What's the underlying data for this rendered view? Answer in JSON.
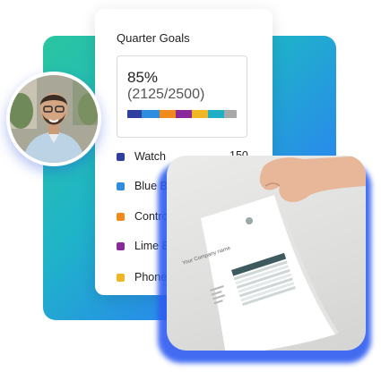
{
  "goals_card": {
    "title": "Quarter Goals",
    "percent": "85%",
    "ratio": "(2125/2500)",
    "progress_fraction": 0.85,
    "segments": [
      "#2f3fa0",
      "#2f8de0",
      "#f08a1c",
      "#8a2a9a",
      "#f1b624",
      "#1fb0c6",
      "#a8a8a8"
    ],
    "legend": [
      {
        "label": "Watch",
        "color": "#2f3fa0",
        "value": "150"
      },
      {
        "label": "Blue Ba",
        "color": "#2f8de0",
        "value": ""
      },
      {
        "label": "Control",
        "color": "#f08a1c",
        "value": ""
      },
      {
        "label": "Lime Ba",
        "color": "#8a2a9a",
        "value": ""
      },
      {
        "label": "Phone C",
        "color": "#f1b624",
        "value": ""
      }
    ]
  },
  "document": {
    "heading": "Your Company name"
  },
  "colors": {
    "accent": "#2e5cf0",
    "gradient_start": "#2ac6a0",
    "gradient_end": "#3a6cf4"
  }
}
